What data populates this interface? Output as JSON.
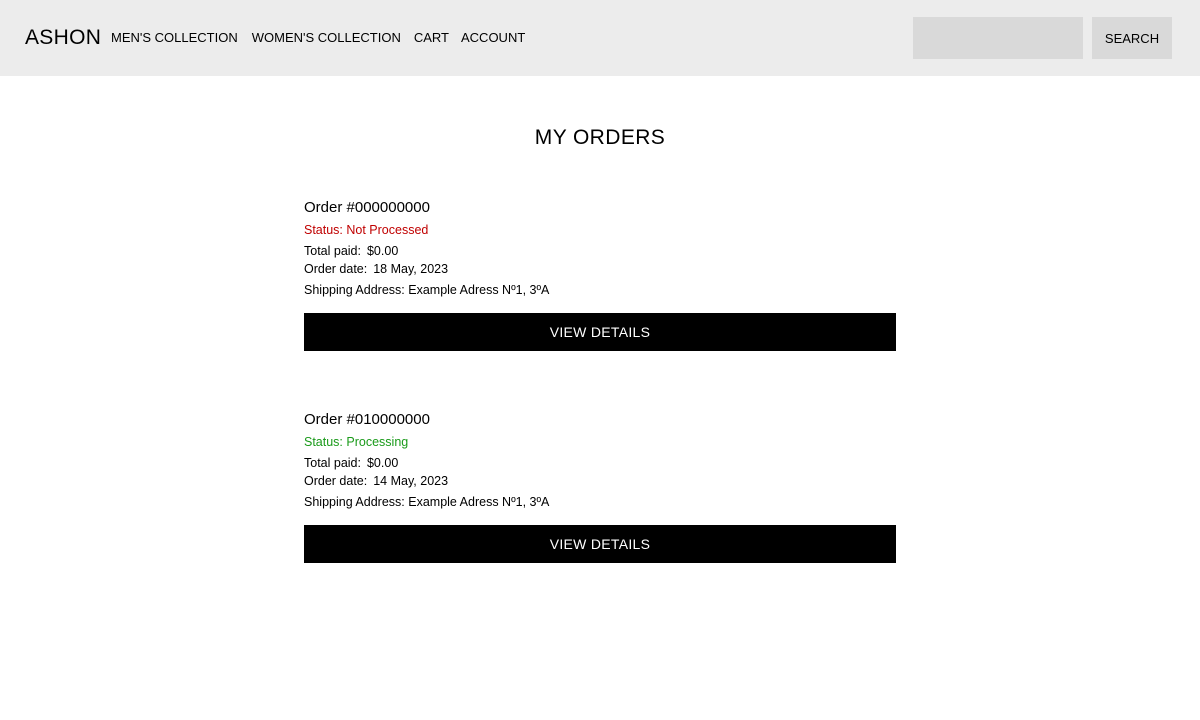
{
  "header": {
    "logo": "ASHON",
    "nav": {
      "mens": "MEN'S COLLECTION",
      "womens": "WOMEN'S COLLECTION",
      "cart": "CART",
      "account": "ACCOUNT"
    },
    "search": {
      "placeholder": "",
      "value": "",
      "button_label": "SEARCH"
    }
  },
  "main": {
    "title": "MY ORDERS",
    "orders": [
      {
        "number": "Order #000000000",
        "status": "Status: Not Processed",
        "status_color": "#c00000",
        "total_label": "Total paid:",
        "total_value": "$0.00",
        "date_label": "Order date:",
        "date_value": "18 May, 2023",
        "address_label": "Shipping Address:",
        "address_value": "Example Adress Nº1, 3ºA",
        "button_label": "VIEW DETAILS"
      },
      {
        "number": "Order #010000000",
        "status": "Status: Processing",
        "status_color": "#1a9a1a",
        "total_label": "Total paid:",
        "total_value": "$0.00",
        "date_label": "Order date:",
        "date_value": "14 May, 2023",
        "address_label": "Shipping Address:",
        "address_value": "Example Adress Nº1, 3ºA",
        "button_label": "VIEW DETAILS"
      }
    ]
  },
  "colors": {
    "header_bg": "#ececec",
    "input_bg": "#d9d9d9",
    "button_bg": "#000000",
    "button_text": "#ffffff"
  }
}
